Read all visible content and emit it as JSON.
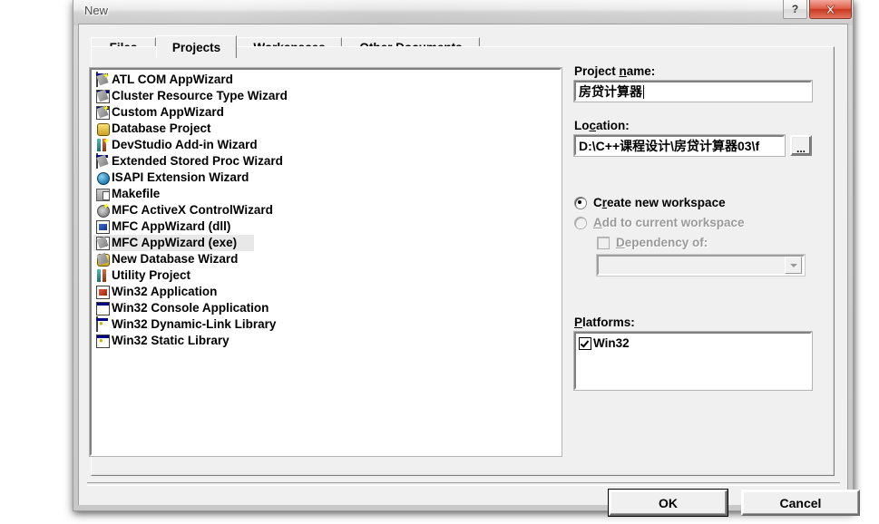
{
  "window": {
    "title": "New",
    "help_button": "?",
    "close_button": "close-icon"
  },
  "tabs": [
    {
      "label": "Files",
      "selected": false
    },
    {
      "label": "Projects",
      "selected": true
    },
    {
      "label": "Workspaces",
      "selected": false
    },
    {
      "label": "Other Documents",
      "selected": false
    }
  ],
  "template_list": {
    "items": [
      {
        "label": "ATL COM AppWizard",
        "icon": "atl-com-appwizard-icon",
        "selected": false
      },
      {
        "label": "Cluster Resource Type Wizard",
        "icon": "cluster-resource-wizard-icon",
        "selected": false
      },
      {
        "label": "Custom AppWizard",
        "icon": "custom-appwizard-icon",
        "selected": false
      },
      {
        "label": "Database Project",
        "icon": "database-project-icon",
        "selected": false
      },
      {
        "label": "DevStudio Add-in Wizard",
        "icon": "devstudio-addin-icon",
        "selected": false
      },
      {
        "label": "Extended Stored Proc Wizard",
        "icon": "extended-stored-proc-icon",
        "selected": false
      },
      {
        "label": "ISAPI Extension Wizard",
        "icon": "isapi-extension-icon",
        "selected": false
      },
      {
        "label": "Makefile",
        "icon": "makefile-icon",
        "selected": false
      },
      {
        "label": "MFC ActiveX ControlWizard",
        "icon": "mfc-activex-icon",
        "selected": false
      },
      {
        "label": "MFC AppWizard (dll)",
        "icon": "mfc-appwizard-dll-icon",
        "selected": false
      },
      {
        "label": "MFC AppWizard (exe)",
        "icon": "mfc-appwizard-exe-icon",
        "selected": true
      },
      {
        "label": "New Database Wizard",
        "icon": "new-database-wizard-icon",
        "selected": false
      },
      {
        "label": "Utility Project",
        "icon": "utility-project-icon",
        "selected": false
      },
      {
        "label": "Win32 Application",
        "icon": "win32-application-icon",
        "selected": false
      },
      {
        "label": "Win32 Console Application",
        "icon": "win32-console-icon",
        "selected": false
      },
      {
        "label": "Win32 Dynamic-Link Library",
        "icon": "win32-dll-icon",
        "selected": false
      },
      {
        "label": "Win32 Static Library",
        "icon": "win32-static-lib-icon",
        "selected": false
      }
    ]
  },
  "project": {
    "name_label_pre": "Project ",
    "name_label_accel": "n",
    "name_label_post": "ame:",
    "name_value": "房贷计算器",
    "location_label_pre": "Lo",
    "location_label_accel": "c",
    "location_label_post": "ation:",
    "location_value": "D:\\C++课程设计\\房贷计算器03\\f",
    "browse_label": "..."
  },
  "workspace": {
    "create_new_pre": "C",
    "create_new_accel": "r",
    "create_new_post": "eate new workspace",
    "add_current_accel": "A",
    "add_current_post": "dd to current workspace",
    "dependency_accel": "D",
    "dependency_post": "ependency of:",
    "dependency_value": "",
    "create_new_checked": true,
    "add_current_checked": false,
    "dependency_checked": false
  },
  "platforms": {
    "label_accel": "P",
    "label_post": "latforms:",
    "items": [
      {
        "label": "Win32",
        "checked": true
      }
    ]
  },
  "buttons": {
    "ok": "OK",
    "cancel": "Cancel"
  },
  "colors": {
    "dialog_face": "#f0f0f0",
    "field_bg": "#ffffff",
    "close_red": "#c73a21",
    "selection": "#e8e8e8",
    "disabled_text": "#9a9a9a"
  }
}
